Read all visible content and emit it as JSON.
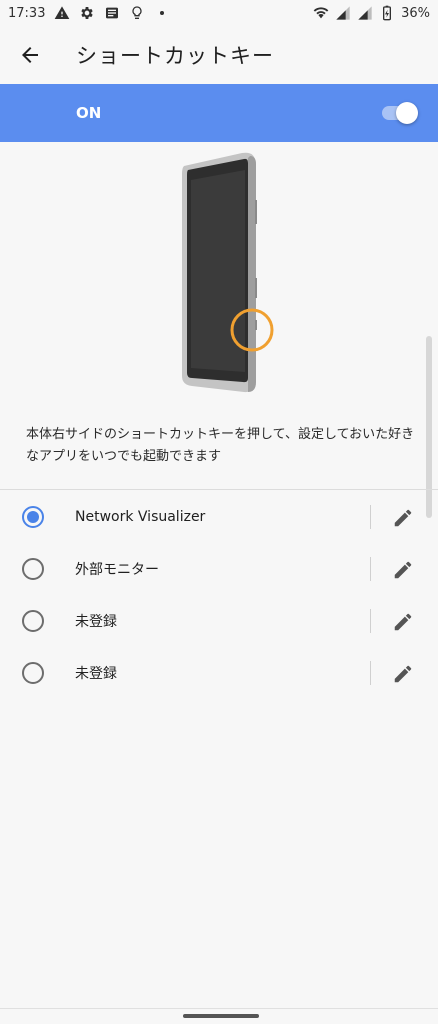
{
  "status_bar": {
    "time": "17:33",
    "battery": "36%",
    "left_icons": [
      "warning-icon",
      "settings-gear-icon",
      "news-icon",
      "lightbulb-icon",
      "dot-icon"
    ],
    "right_icons": [
      "wifi-icon",
      "signal-1-icon",
      "signal-2-icon",
      "battery-charging-icon"
    ]
  },
  "app_bar": {
    "title": "ショートカットキー",
    "back_icon": "arrow-left-icon"
  },
  "master_switch": {
    "label": "ON",
    "enabled": true,
    "accent_color": "#5b8def"
  },
  "description": "本体右サイドのショートカットキーを押して、設定しておいた好きなアプリをいつでも起動できます",
  "options": [
    {
      "label": "Network Visualizer",
      "selected": true
    },
    {
      "label": "外部モニター",
      "selected": false
    },
    {
      "label": "未登録",
      "selected": false
    },
    {
      "label": "未登録",
      "selected": false
    }
  ],
  "colors": {
    "radio_selected": "#4a83e8",
    "highlight_circle": "#f0a030"
  }
}
